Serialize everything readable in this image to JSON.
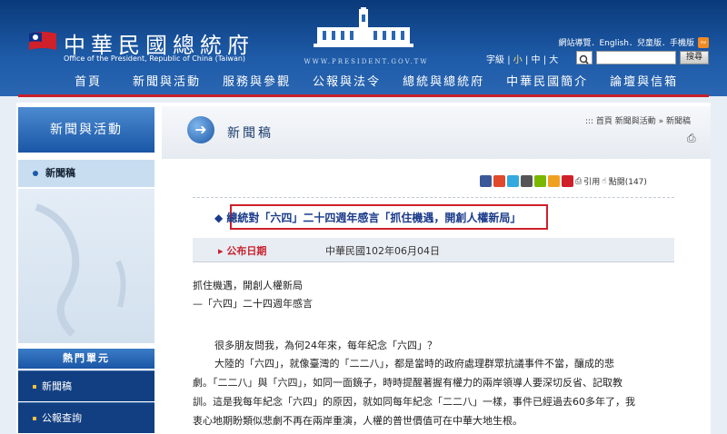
{
  "header": {
    "title": "中華民國總統府",
    "subtitle": "Office of the President, Republic of China (Taiwan)",
    "url_text": "WWW.PRESIDENT.GOV.TW",
    "top_links": "網站導覽．English．兒童版．手機版",
    "font_size_label": "字級",
    "font_small": "小",
    "font_medium": "中",
    "font_large": "大",
    "search_placeholder": "",
    "search_button": "搜尋"
  },
  "nav": [
    "首頁",
    "新聞與活動",
    "服務與參觀",
    "公報與法令",
    "總統與總統府",
    "中華民國簡介",
    "論壇與信箱"
  ],
  "sidebar": {
    "title": "新聞與活動",
    "items": [
      {
        "label": "新聞稿"
      }
    ],
    "hot_title": "熱門單元",
    "hot_items": [
      {
        "label": "新聞稿"
      },
      {
        "label": "公報查詢"
      }
    ]
  },
  "content": {
    "section_title": "新聞稿",
    "breadcrumb": "::: 首頁 新聞與活動 » 新聞稿",
    "share": {
      "cite": "引用",
      "clicks": "點閱(147)"
    },
    "article_title": "◆ 總統對「六四」二十四週年感言「抓住機遇，開創人權新局」",
    "date_label": "公布日期",
    "date_value": "中華民國102年06月04日",
    "paragraphs": [
      "抓住機遇，開創人權新局",
      "—「六四」二十四週年感言",
      "很多朋友問我，為何24年來，每年紀念「六四」？",
      "大陸的「六四」，就像臺灣的「二二八」，都是當時的政府處理群眾抗議事件不當，釀成的悲",
      "劇。「二二八」與「六四」，如同一面鏡子，時時提醒著握有權力的兩岸領導人要深切反省、記取教",
      "訓。這是我每年紀念「六四」的原因，就如同每年紀念「二二八」一樣，事件已經過去60多年了，我",
      "衷心地期盼類似悲劇不再在兩岸重演，人權的普世價值可在中華大地生根。"
    ]
  },
  "colors": {
    "header": "#1e5ba8",
    "accent_red": "#c8202c",
    "sidebar_dark": "#123f82"
  }
}
